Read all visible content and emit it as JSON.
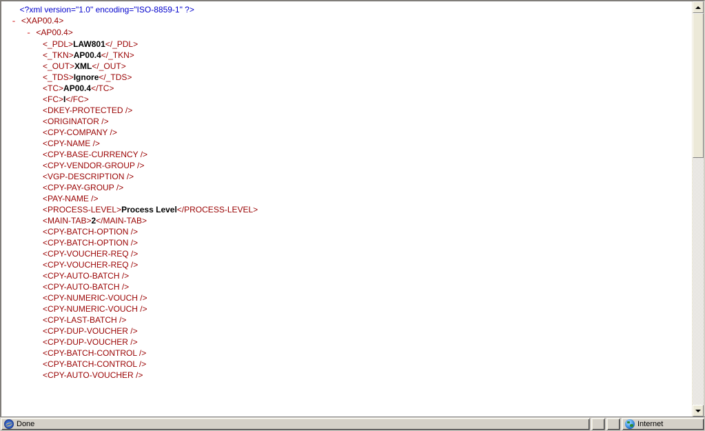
{
  "xml_decl": "<?xml version=\"1.0\" encoding=\"ISO-8859-1\" ?>",
  "root": {
    "tag": "XAP00.4"
  },
  "child": {
    "tag": "AP00.4"
  },
  "leaves": [
    {
      "tag": "_PDL",
      "value": "LAW801"
    },
    {
      "tag": "_TKN",
      "value": "AP00.4"
    },
    {
      "tag": "_OUT",
      "value": "XML"
    },
    {
      "tag": "_TDS",
      "value": "Ignore"
    },
    {
      "tag": "TC",
      "value": "AP00.4"
    },
    {
      "tag": "FC",
      "value": "I"
    },
    {
      "tag": "DKEY-PROTECTED",
      "self_closing": true
    },
    {
      "tag": "ORIGINATOR",
      "self_closing": true
    },
    {
      "tag": "CPY-COMPANY",
      "self_closing": true
    },
    {
      "tag": "CPY-NAME",
      "self_closing": true
    },
    {
      "tag": "CPY-BASE-CURRENCY",
      "self_closing": true
    },
    {
      "tag": "CPY-VENDOR-GROUP",
      "self_closing": true
    },
    {
      "tag": "VGP-DESCRIPTION",
      "self_closing": true
    },
    {
      "tag": "CPY-PAY-GROUP",
      "self_closing": true
    },
    {
      "tag": "PAY-NAME",
      "self_closing": true
    },
    {
      "tag": "PROCESS-LEVEL",
      "value": "Process Level"
    },
    {
      "tag": "MAIN-TAB",
      "value": "2"
    },
    {
      "tag": "CPY-BATCH-OPTION",
      "self_closing": true
    },
    {
      "tag": "CPY-BATCH-OPTION",
      "self_closing": true
    },
    {
      "tag": "CPY-VOUCHER-REQ",
      "self_closing": true
    },
    {
      "tag": "CPY-VOUCHER-REQ",
      "self_closing": true
    },
    {
      "tag": "CPY-AUTO-BATCH",
      "self_closing": true
    },
    {
      "tag": "CPY-AUTO-BATCH",
      "self_closing": true
    },
    {
      "tag": "CPY-NUMERIC-VOUCH",
      "self_closing": true
    },
    {
      "tag": "CPY-NUMERIC-VOUCH",
      "self_closing": true
    },
    {
      "tag": "CPY-LAST-BATCH",
      "self_closing": true
    },
    {
      "tag": "CPY-DUP-VOUCHER",
      "self_closing": true
    },
    {
      "tag": "CPY-DUP-VOUCHER",
      "self_closing": true
    },
    {
      "tag": "CPY-BATCH-CONTROL",
      "self_closing": true
    },
    {
      "tag": "CPY-BATCH-CONTROL",
      "self_closing": true
    },
    {
      "tag": "CPY-AUTO-VOUCHER",
      "self_closing": true
    }
  ],
  "status": {
    "done": "Done",
    "zone": "Internet"
  }
}
